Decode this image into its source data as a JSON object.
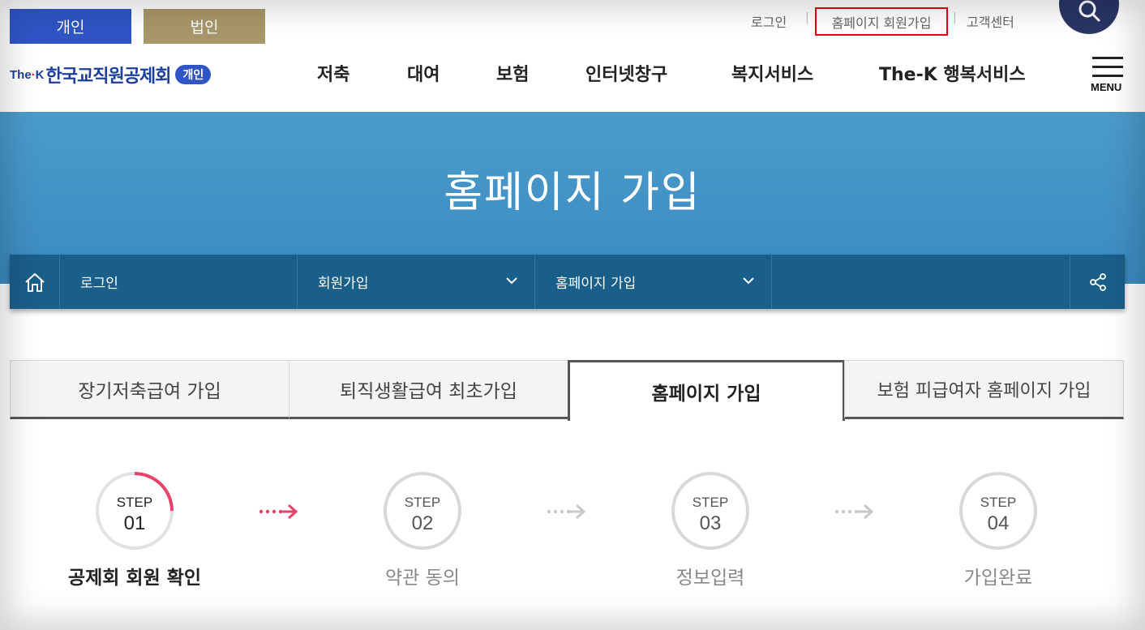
{
  "header": {
    "member_types": [
      "개인",
      "법인"
    ],
    "util_links": [
      "로그인",
      "홈페이지 회원가입",
      "고객센터"
    ],
    "logo": {
      "thek": "The",
      "thek_k": "K",
      "name": "한국교직원공제회",
      "badge": "개인"
    },
    "gnb": [
      "저축",
      "대여",
      "보험",
      "인터넷창구",
      "복지서비스",
      "The-K 행복서비스"
    ],
    "menu_label": "MENU"
  },
  "hero": {
    "title": "홈페이지 가입"
  },
  "location": {
    "items": [
      "로그인",
      "회원가입",
      "홈페이지 가입"
    ]
  },
  "tabs": [
    {
      "label": "장기저축급여 가입",
      "active": false
    },
    {
      "label": "퇴직생활급여 최초가입",
      "active": false
    },
    {
      "label": "홈페이지 가입",
      "active": true
    },
    {
      "label": "보험 피급여자 홈페이지 가입",
      "active": false
    }
  ],
  "steps": [
    {
      "label": "STEP",
      "num": "01",
      "name": "공제회 회원 확인",
      "active": true,
      "progress": 0.25
    },
    {
      "label": "STEP",
      "num": "02",
      "name": "약관 동의",
      "active": false,
      "progress": 0
    },
    {
      "label": "STEP",
      "num": "03",
      "name": "정보입력",
      "active": false,
      "progress": 0
    },
    {
      "label": "STEP",
      "num": "04",
      "name": "가입완료",
      "active": false,
      "progress": 0
    }
  ],
  "colors": {
    "personal": "#2f55c6",
    "corporate": "#a8976a",
    "highlight_border": "#e60012",
    "hero": "#4b9bcc",
    "locbar": "#1a5e8a",
    "step_active": "#e8416a",
    "step_inactive": "#d8d8d8"
  }
}
